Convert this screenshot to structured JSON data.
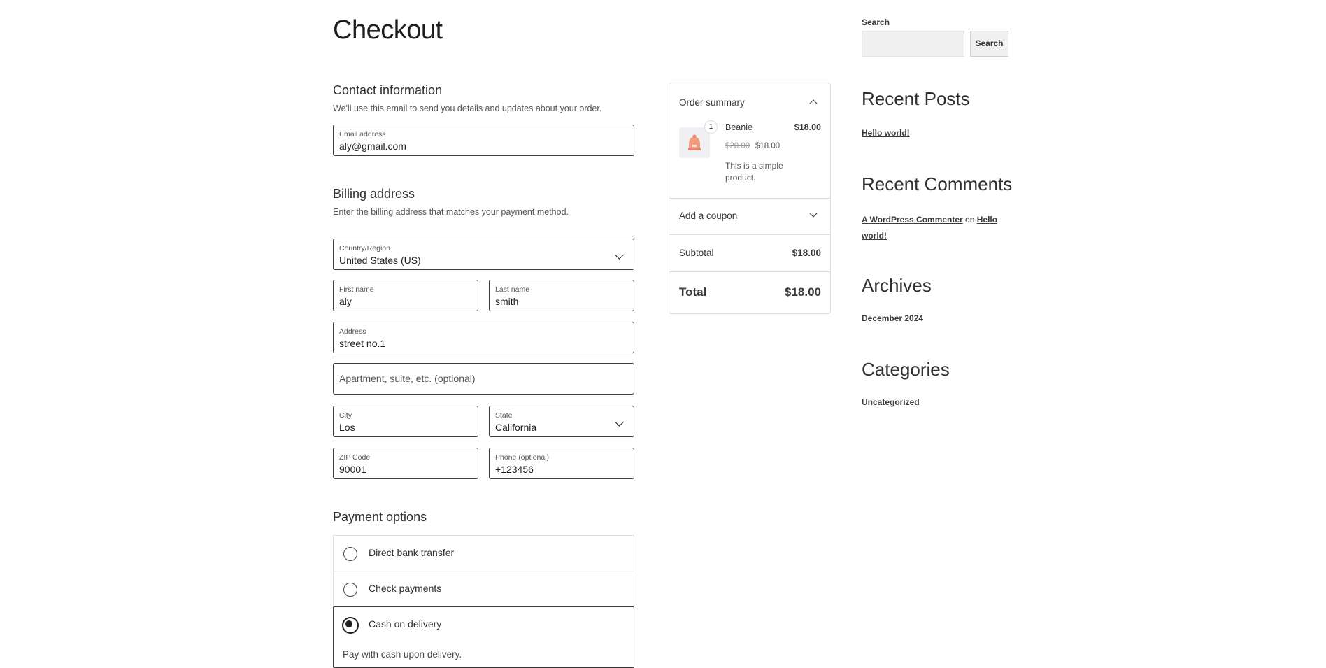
{
  "page": {
    "title": "Checkout"
  },
  "contact": {
    "title": "Contact information",
    "description": "We'll use this email to send you details and updates about your order.",
    "email_label": "Email address",
    "email_value": "aly@gmail.com"
  },
  "billing": {
    "title": "Billing address",
    "description": "Enter the billing address that matches your payment method.",
    "country_label": "Country/Region",
    "country_value": "United States (US)",
    "first_name_label": "First name",
    "first_name_value": "aly",
    "last_name_label": "Last name",
    "last_name_value": "smith",
    "address_label": "Address",
    "address_value": "street no.1",
    "apartment_placeholder": "Apartment, suite, etc. (optional)",
    "city_label": "City",
    "city_value": "Los",
    "state_label": "State",
    "state_value": "California",
    "zip_label": "ZIP Code",
    "zip_value": "90001",
    "phone_label": "Phone (optional)",
    "phone_value": "+123456"
  },
  "payment": {
    "title": "Payment options",
    "options": [
      {
        "label": "Direct bank transfer",
        "selected": false
      },
      {
        "label": "Check payments",
        "selected": false
      },
      {
        "label": "Cash on delivery",
        "selected": true
      }
    ],
    "selected_description": "Pay with cash upon delivery."
  },
  "summary": {
    "title": "Order summary",
    "item": {
      "name": "Beanie",
      "quantity": "1",
      "price": "$18.00",
      "regular_price": "$20.00",
      "sale_price": "$18.00",
      "description": "This is a simple product.",
      "image_icon": "beanie-icon"
    },
    "coupon_label": "Add a coupon",
    "subtotal_label": "Subtotal",
    "subtotal_value": "$18.00",
    "total_label": "Total",
    "total_value": "$18.00"
  },
  "sidebar": {
    "search_label": "Search",
    "search_button": "Search",
    "recent_posts_title": "Recent Posts",
    "recent_posts": [
      "Hello world!"
    ],
    "recent_comments_title": "Recent Comments",
    "comment_author": "A WordPress Commenter",
    "comment_on": "on",
    "comment_post": "Hello world!",
    "archives_title": "Archives",
    "archives": [
      "December 2024"
    ],
    "categories_title": "Categories",
    "categories": [
      "Uncategorized"
    ]
  },
  "colors": {
    "border": "#3a3a3a",
    "muted_border": "#dcdcdc",
    "text": "#2f2f2f"
  }
}
